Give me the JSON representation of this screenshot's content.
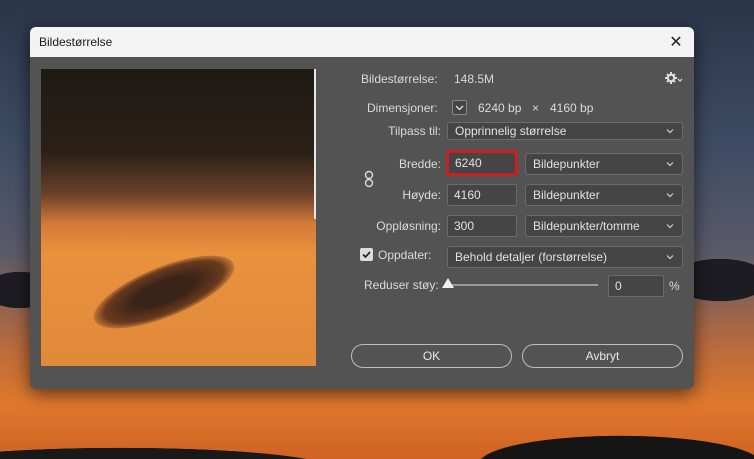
{
  "dialog": {
    "title": "Bildestørrelse",
    "close_glyph": "✕"
  },
  "info": {
    "size_label": "Bildestørrelse:",
    "size_value": "148.5M",
    "dimensions_label": "Dimensjoner:",
    "width_px": "6240 bp",
    "times": "×",
    "height_px": "4160 bp"
  },
  "fit": {
    "label": "Tilpass til:",
    "value": "Opprinnelig størrelse"
  },
  "width": {
    "label": "Bredde:",
    "value": "6240",
    "unit": "Bildepunkter"
  },
  "height": {
    "label": "Høyde:",
    "value": "4160",
    "unit": "Bildepunkter"
  },
  "resolution": {
    "label": "Oppløsning:",
    "value": "300",
    "unit": "Bildepunkter/tomme"
  },
  "resample": {
    "label": "Oppdater:",
    "checked": true,
    "value": "Behold detaljer (forstørrelse)"
  },
  "noise": {
    "label": "Reduser støy:",
    "value": "0",
    "unit": "%",
    "level_percent": 0
  },
  "buttons": {
    "ok": "OK",
    "cancel": "Avbryt"
  },
  "icons": {
    "gear": "gear-icon",
    "link": "link-chain-icon",
    "check": "checkmark-icon",
    "chevron": "chevron-down-icon",
    "close": "close-icon"
  },
  "colors": {
    "dialog_bg": "#535353",
    "highlight": "#cc1f1f"
  }
}
